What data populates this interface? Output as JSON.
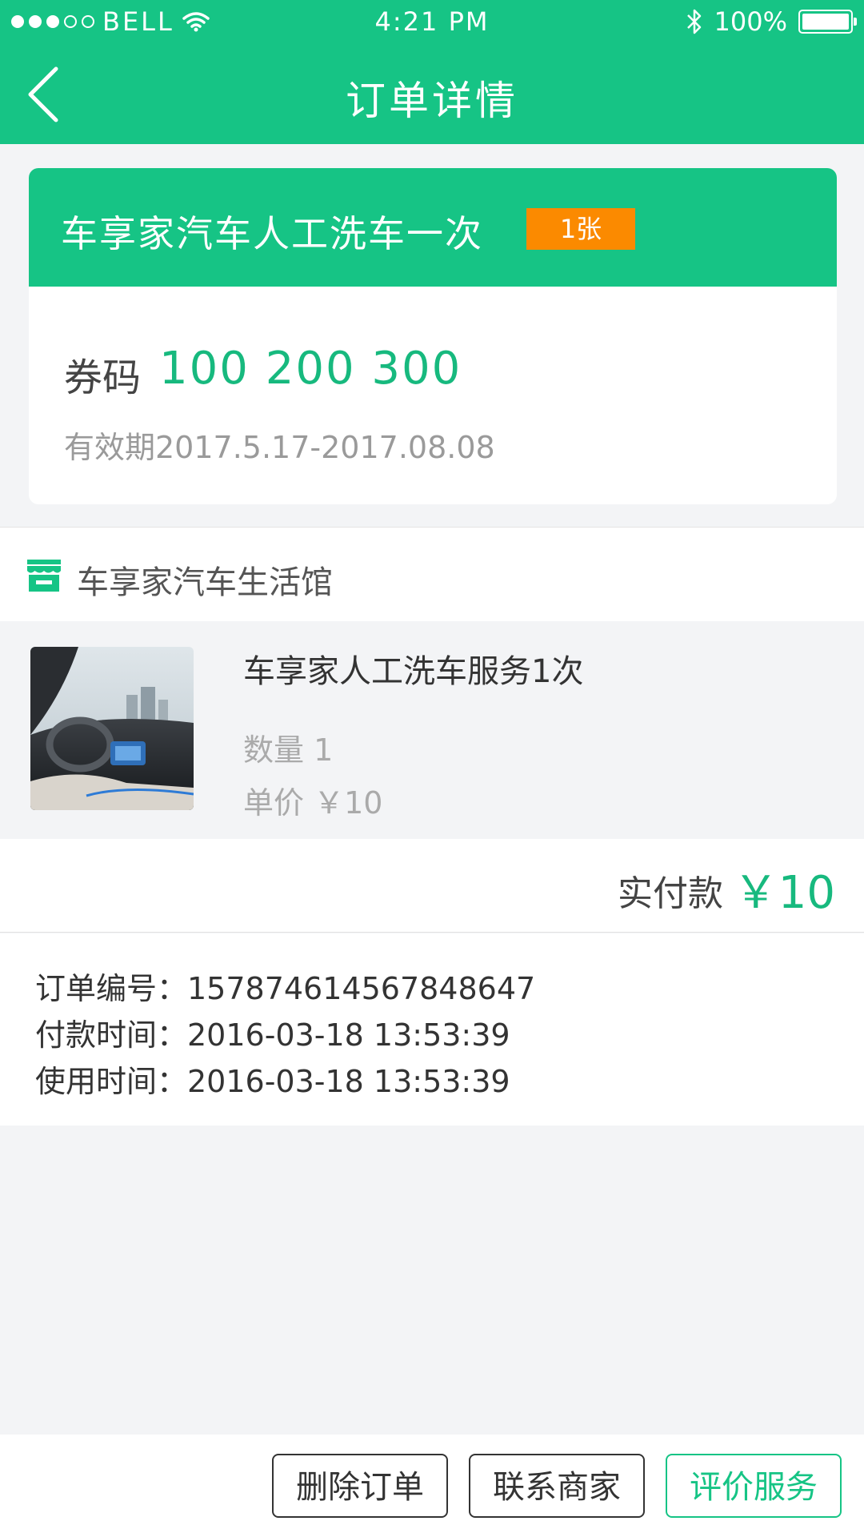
{
  "status_bar": {
    "carrier": "BELL",
    "time": "4:21 PM",
    "battery": "100%"
  },
  "nav": {
    "title": "订单详情"
  },
  "voucher": {
    "title": "车享家汽车人工洗车一次",
    "badge": "1张",
    "code_label": "券码",
    "code": "100 200 300",
    "validity": "有效期2017.5.17-2017.08.08"
  },
  "shop": {
    "name": "车享家汽车生活馆"
  },
  "product": {
    "name": "车享家人工洗车服务1次",
    "quantity": "数量 1",
    "unit_price": "单价 ￥10"
  },
  "payment": {
    "label": "实付款",
    "amount": "￥10"
  },
  "order_info": {
    "order_no": "订单编号：157874614567848647",
    "pay_time": "付款时间：2016-03-18 13:53:39",
    "use_time": "使用时间：2016-03-18 13:53:39"
  },
  "actions": {
    "delete": "删除订单",
    "contact": "联系商家",
    "review": "评价服务"
  },
  "colors": {
    "brand": "#16c485",
    "badge": "#fb8a00"
  }
}
